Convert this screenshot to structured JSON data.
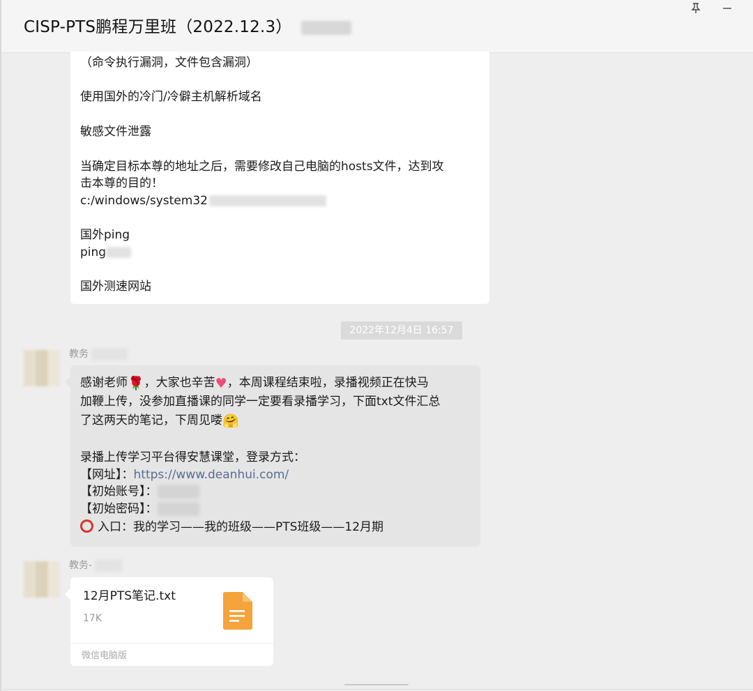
{
  "window": {
    "title": "CISP-PTS鹏程万里班（2022.12.3）",
    "pin_icon": "pin-icon",
    "minimize_icon": "minimize-icon"
  },
  "messages": {
    "first": {
      "lines": [
        "（命令执行漏洞，文件包含漏洞）",
        "使用国外的冷门/冷僻主机解析域名",
        "敏感文件泄露",
        "当确定目标本尊的地址之后，需要修改自己电脑的hosts文件，达到攻",
        "击本尊的目的！",
        "c:/windows/system32",
        "国外ping",
        "ping",
        "国外测速网站"
      ]
    },
    "timestamp": "2022年12月4日 16:57",
    "second": {
      "sender": "教务",
      "line1_a": "感谢老师",
      "line1_b": "，大家也辛苦",
      "line1_c": "，本周课程结束啦，录播视频正在快马",
      "line2": "加鞭上传，没参加直播课的同学一定要看录播学习，下面txt文件汇总",
      "line3": "了这两天的笔记，下周见喽",
      "line4": "录播上传学习平台得安慧课堂，登录方式：",
      "url_label": "【网址】：",
      "url": "https://www.deanhui.com/",
      "account_label": "【初始账号】：",
      "password_label": "【初始密码】：",
      "entry": "入口：我的学习——我的班级——PTS班级——12月期",
      "emoji_rose": "🌹",
      "emoji_heart": "♥",
      "emoji_hug": "🤗"
    },
    "third": {
      "sender": "教务-",
      "file_name": "12月PTS笔记.txt",
      "file_size": "17K",
      "source": "微信电脑版",
      "file_icon_color": "#f5a33b"
    }
  }
}
